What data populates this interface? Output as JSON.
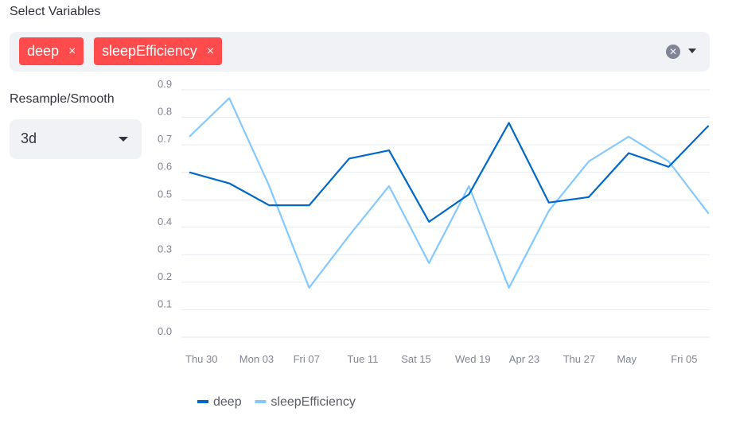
{
  "select_variables": {
    "label": "Select Variables",
    "tags": [
      {
        "label": "deep",
        "remove": "×"
      },
      {
        "label": "sleepEfficiency",
        "remove": "×"
      }
    ],
    "clear_icon": "clear-circle-icon",
    "dropdown_icon": "caret-down-icon"
  },
  "resample": {
    "label": "Resample/Smooth",
    "value": "3d"
  },
  "colors": {
    "tag": "#ff4b4b",
    "deep": "#0068c9",
    "sleepEfficiency": "#83c9ff"
  },
  "chart_data": {
    "type": "line",
    "categories": [
      "Thu 30",
      "",
      "Mon 03",
      "",
      "Fri 07",
      "",
      "Tue 11",
      "",
      "Sat 15",
      "",
      "Wed 19",
      "",
      "Apr 23",
      "",
      "Thu 27",
      "",
      "May",
      "",
      "Fri 05",
      ""
    ],
    "x_tick_labels": [
      "Thu 30",
      "Mon 03",
      "Fri 07",
      "Tue 11",
      "Sat 15",
      "Wed 19",
      "Apr 23",
      "Thu 27",
      "May",
      "Fri 05"
    ],
    "ylim": [
      0,
      0.9
    ],
    "y_ticks": [
      "0.0",
      "0.1",
      "0.2",
      "0.3",
      "0.4",
      "0.5",
      "0.6",
      "0.7",
      "0.8",
      "0.9"
    ],
    "grid": true,
    "legend_position": "bottom",
    "series": [
      {
        "name": "deep",
        "color": "#0068c9",
        "values": [
          0.6,
          0.56,
          0.48,
          0.48,
          0.65,
          0.68,
          0.42,
          0.52,
          0.78,
          0.49,
          0.51,
          0.67,
          0.62,
          0.77
        ]
      },
      {
        "name": "sleepEfficiency",
        "color": "#83c9ff",
        "values": [
          0.73,
          0.87,
          0.55,
          0.18,
          0.37,
          0.55,
          0.27,
          0.55,
          0.18,
          0.46,
          0.64,
          0.73,
          0.64,
          0.45
        ]
      }
    ]
  }
}
